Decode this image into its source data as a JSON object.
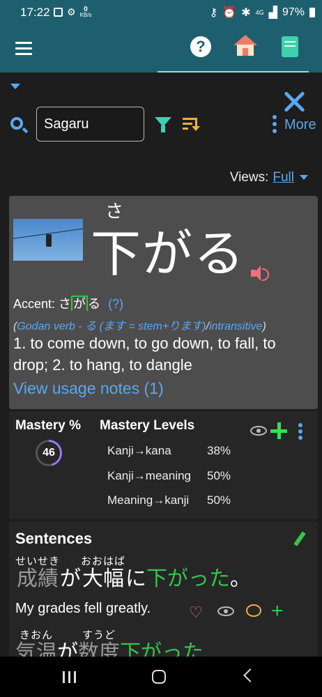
{
  "status": {
    "time": "17:22",
    "kbs_top": "0",
    "kbs_bottom": "KB/s",
    "network": "4G",
    "battery": "97%"
  },
  "toolbar": {
    "search_value": "Sagaru",
    "more_label": "More",
    "views_label": "Views:",
    "views_value": "Full"
  },
  "entry": {
    "furigana": "さ",
    "kanji": "下がる",
    "accent_label": "Accent:",
    "accent_pre": "さ",
    "accent_box": "が",
    "accent_post": "る",
    "accent_help": "(?)",
    "grammar_open": "(",
    "grammar_main": "Godan verb - る (ます = stem+ります)",
    "grammar_sep": "/",
    "grammar_second": "intransitive",
    "grammar_close": ")",
    "meaning": "1. to come down, to go down, to fall, to drop; 2. to hang, to dangle",
    "usage_notes": "View usage notes (1)"
  },
  "mastery": {
    "title": "Mastery %",
    "percent": "46",
    "levels_title": "Mastery Levels",
    "levels": [
      {
        "label": "Kanji→kana",
        "value": "38%"
      },
      {
        "label": "Kanji→meaning",
        "value": "50%"
      },
      {
        "label": "Meaning→kanji",
        "value": "50%"
      }
    ]
  },
  "sentences": {
    "title": "Sentences",
    "items": [
      {
        "segments": [
          {
            "rt": "せいせき",
            "rb": "成績"
          },
          {
            "rt": "",
            "rb": "が"
          },
          {
            "rt": "おおはば",
            "rb": "大幅"
          },
          {
            "rt": "",
            "rb": "に"
          },
          {
            "rt": "",
            "rb": "下がった"
          },
          {
            "rt": "",
            "rb": "。"
          }
        ],
        "translation": "My grades fell greatly."
      },
      {
        "segments": [
          {
            "rt": "きおん",
            "rb": "気温"
          },
          {
            "rt": "",
            "rb": "が"
          },
          {
            "rt": "すうど",
            "rb": "数度"
          },
          {
            "rt": "",
            "rb": "下がった"
          }
        ]
      }
    ]
  }
}
